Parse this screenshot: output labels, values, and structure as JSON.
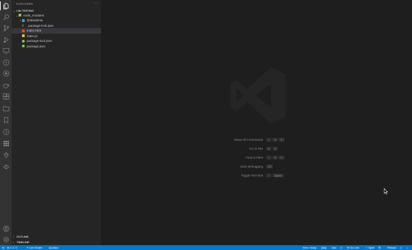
{
  "activity_bar": {
    "icons": [
      "files-icon",
      "search-icon",
      "source-control-icon",
      "run-debug-icon",
      "remote-explorer-icon",
      "lightning-icon",
      "database-icon",
      "coffee-icon",
      "extensions-icon",
      "folder-icon",
      "bookmark-icon",
      "live-share-icon",
      "grid-icon",
      "deploy-icon",
      "docker-icon"
    ],
    "bottom_icons": [
      "account-icon",
      "settings-gear-icon"
    ]
  },
  "sidebar": {
    "title": "EXPLORER",
    "more": "···",
    "root": "LIB-TESTING",
    "tree": [
      {
        "label": "node_modules",
        "indent": 1,
        "twistie": "⌄",
        "icon": "folder-green"
      },
      {
        "label": "@akadenia",
        "indent": 2,
        "twistie": "›",
        "icon": "folder-blue"
      },
      {
        "label": ".package-lock.json",
        "indent": 2,
        "twistie": "",
        "icon": "json-icon"
      },
      {
        "label": "index.html",
        "indent": 1,
        "twistie": "",
        "icon": "html-icon",
        "selected": true
      },
      {
        "label": "index.js",
        "indent": 1,
        "twistie": "",
        "icon": "js-icon"
      },
      {
        "label": "package-lock.json",
        "indent": 1,
        "twistie": "",
        "icon": "json-green"
      },
      {
        "label": "package.json",
        "indent": 1,
        "twistie": "",
        "icon": "json-green"
      }
    ],
    "outline": "OUTLINE",
    "timeline": "TIMELINE"
  },
  "editor": {
    "shortcuts": [
      {
        "label": "Show All Commands",
        "keys": [
          "⇧",
          "⌘",
          "P"
        ]
      },
      {
        "label": "Go to File",
        "keys": [
          "⌘",
          "P"
        ]
      },
      {
        "label": "Find in Files",
        "keys": [
          "⇧",
          "⌘",
          "F"
        ]
      },
      {
        "label": "Start Debugging",
        "keys": [
          "F5"
        ]
      },
      {
        "label": "Toggle Terminal",
        "keys": [
          "⌃",
          "Space"
        ]
      }
    ]
  },
  "statusbar": {
    "problems": "⊗ 0 ⚠ 0",
    "live_share": "Live Share",
    "quokka": "Quokka",
    "breadcrumb": "html › body",
    "aa": "[Aa]",
    "abc": "Abc",
    "go_live": "Go Live",
    "spell": "Spell",
    "reload": "Reload"
  },
  "colors": {
    "activity_bar": "#333333",
    "sidebar": "#252526",
    "editor": "#1e1e1e",
    "statusbar": "#007acc"
  }
}
